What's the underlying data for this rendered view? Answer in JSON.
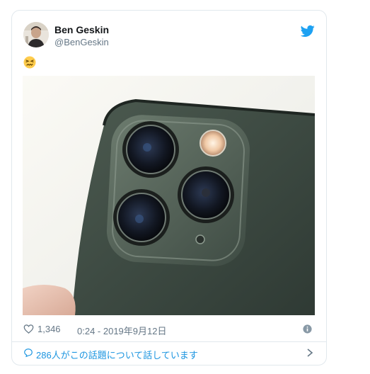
{
  "tweet": {
    "author_name": "Ben Geskin",
    "author_handle": "@BenGeskin",
    "emoji": "😖",
    "likes": "1,346",
    "timestamp": "0:24 - 2019年9月12日",
    "conversation": "286人がこの話題について話しています"
  },
  "icons": {
    "logo": "twitter-bird-icon",
    "like": "heart-icon",
    "info": "info-icon",
    "reply": "speech-bubble-icon",
    "more": "chevron-right-icon"
  },
  "colors": {
    "brand": "#1da1f2",
    "link": "#1b95e0",
    "secondary_text": "#657786",
    "border": "#e1e8ed"
  }
}
